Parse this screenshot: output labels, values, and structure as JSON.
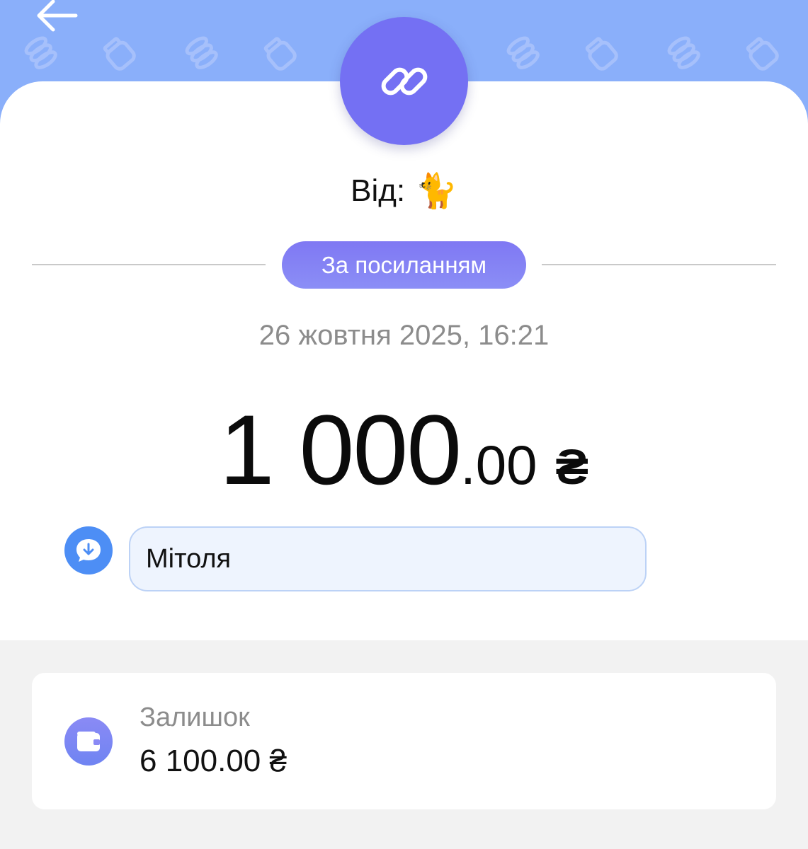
{
  "header": {
    "back_icon": "arrow-left-icon",
    "pattern_icons": [
      "coins-icon",
      "jar-icon"
    ],
    "background_color": "#8aaffa"
  },
  "transaction": {
    "type_icon": "link-icon",
    "from_label": "Від:",
    "from_emoji": "🐈",
    "type_label": "За посиланням",
    "datetime": "26 жовтня 2025, 16:21",
    "amount_integer": "1 000",
    "amount_decimal": ".00",
    "currency": "₴",
    "comment_icon": "comment-download-icon",
    "comment": "Мітоля",
    "accent_color": "#7470f3"
  },
  "balance": {
    "icon": "wallet-icon",
    "label": "Залишок",
    "value": "6 100.00 ₴"
  }
}
